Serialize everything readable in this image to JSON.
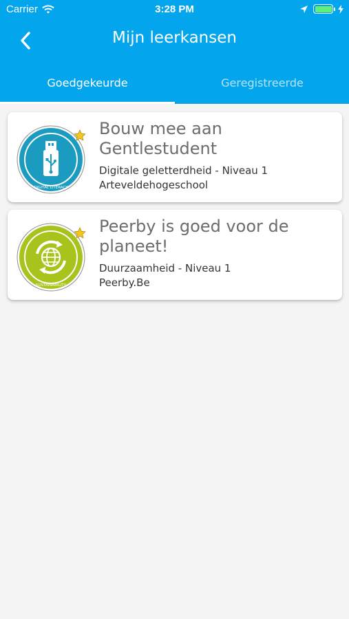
{
  "status_bar": {
    "carrier": "Carrier",
    "time": "3:28 PM",
    "icons": [
      "wifi-icon",
      "location-arrow-icon",
      "battery-icon",
      "charging-bolt-icon"
    ]
  },
  "nav": {
    "title": "Mijn leerkansen",
    "back_icon": "chevron-left-icon"
  },
  "tabs": [
    {
      "label": "Goedgekeurde",
      "active": true
    },
    {
      "label": "Geregistreerde",
      "active": false
    }
  ],
  "cards": [
    {
      "title": "Bouw mee aan Gentlestudent",
      "category": "Digitale geletterdheid - Niveau 1",
      "organization": "Arteveldehogeschool",
      "badge": {
        "icon": "usb-stick-icon",
        "ring_text": "DIGITAL LITERACY",
        "color": "#1b9bc0"
      }
    },
    {
      "title": "Peerby is goed voor de planeet!",
      "category": "Duurzaamheid - Niveau 1",
      "organization": "Peerby.Be",
      "badge": {
        "icon": "recycling-globe-icon",
        "ring_text": "SUSTAINABILITY",
        "color": "#a7c31c"
      }
    }
  ],
  "colors": {
    "header": "#03a6ec",
    "background": "#f4f4f4",
    "title_gray": "#6c6c6c",
    "star": "#f5c518"
  }
}
